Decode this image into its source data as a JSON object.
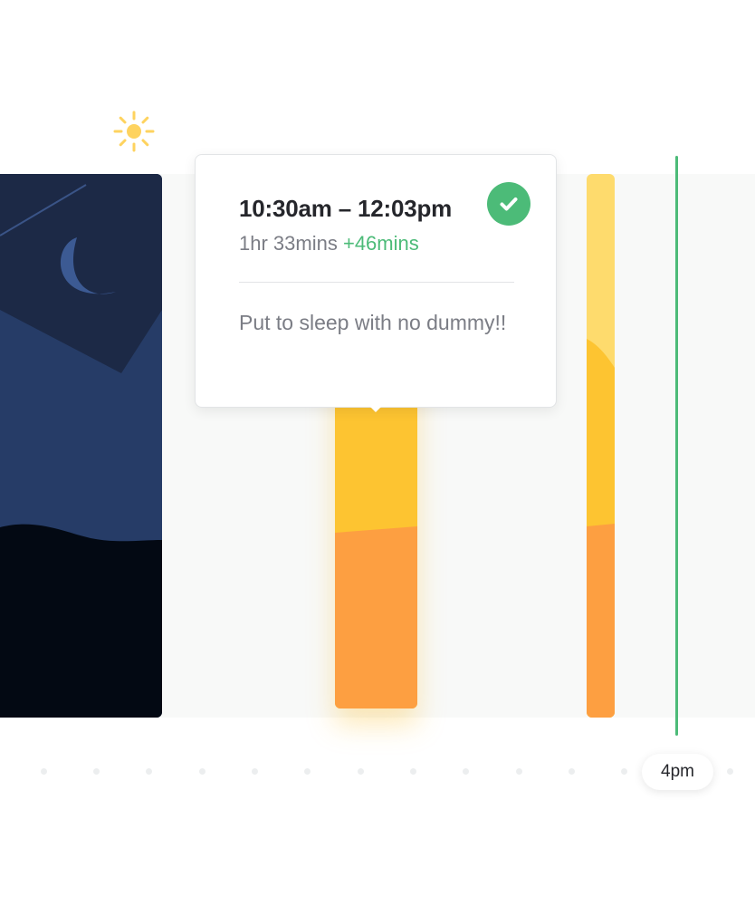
{
  "icons": {
    "sun": "sun-icon",
    "moon": "moon-icon",
    "check": "check-icon"
  },
  "colors": {
    "sun": "#fed35f",
    "night_dark": "#1c2946",
    "night_mid": "#263c67",
    "night_bottom": "#030913",
    "moon": "#3c5a93",
    "nap_yellow": "#fdc431",
    "nap_orange": "#fd9f41",
    "nap_light": "#fedb6d",
    "now_line": "#4cbb78",
    "check_badge": "#4cbb78"
  },
  "popover": {
    "time_range": "10:30am – 12:03pm",
    "duration": "1hr 33mins",
    "delta": "+46mins",
    "note": "Put to sleep with no dummy!!",
    "completed": true
  },
  "timeline": {
    "now_label": "4pm"
  }
}
